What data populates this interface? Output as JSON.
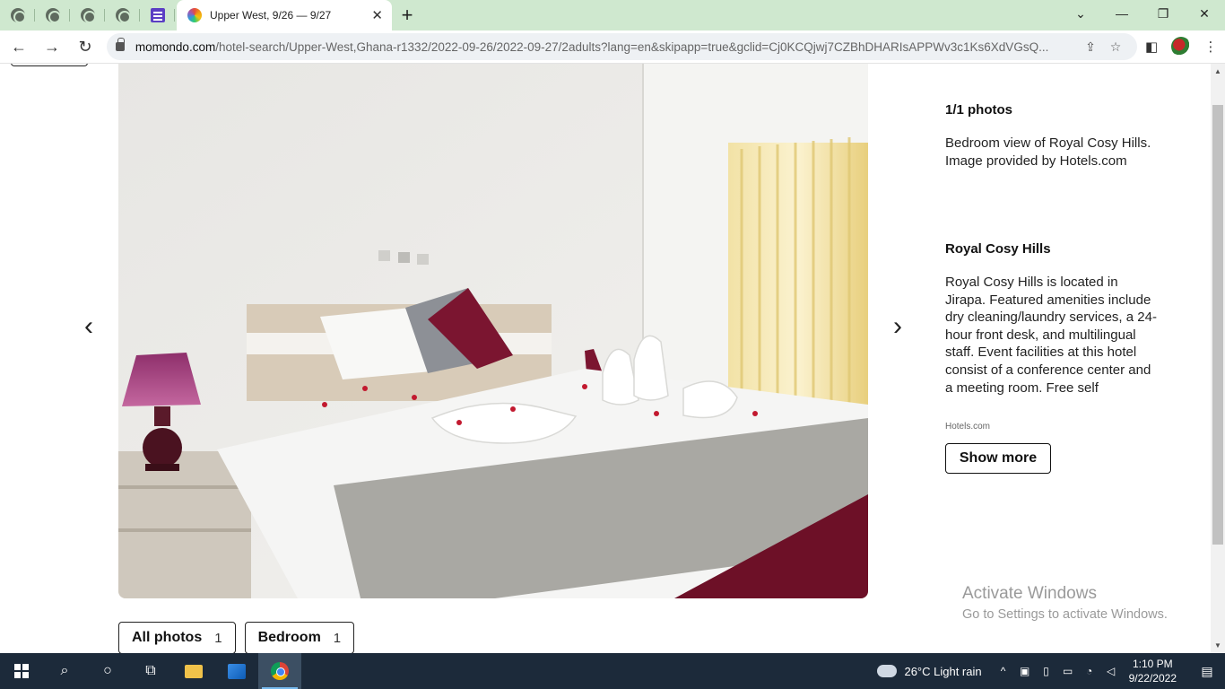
{
  "browser": {
    "tab_title": "Upper West, 9/26 — 9/27",
    "url_domain": "momondo.com",
    "url_path": "/hotel-search/Upper-West,Ghana-r1332/2022-09-26/2022-09-27/2adults?lang=en&skipapp=true&gclid=Cj0KCQjwj7CZBhDHARIsAPPWv3c1Ks6XdVGsQ...",
    "icons": [
      "globe-icon",
      "sheets-icon",
      "momondo-favicon",
      "close-icon",
      "new-tab-icon",
      "back-icon",
      "forward-icon",
      "reload-icon",
      "lock-icon",
      "share-icon",
      "star-icon",
      "side-panel-icon",
      "avatar"
    ]
  },
  "gallery": {
    "photo_count": "1/1 photos",
    "photo_caption": "Bedroom view of Royal Cosy Hills. Image provided by Hotels.com"
  },
  "hotel": {
    "name": "Royal Cosy Hills",
    "description": "Royal Cosy Hills is located in Jirapa. Featured amenities include dry cleaning/laundry services, a 24-hour front desk, and multilingual staff. Event facilities at this hotel consist of a conference center and a meeting room. Free self",
    "source": "Hotels.com",
    "show_more_label": "Show more"
  },
  "filters": [
    {
      "label": "All photos",
      "count": "1"
    },
    {
      "label": "Bedroom",
      "count": "1"
    }
  ],
  "watermark": {
    "line1": "Activate Windows",
    "line2": "Go to Settings to activate Windows."
  },
  "taskbar": {
    "weather": "26°C  Light rain",
    "time": "1:10 PM",
    "date": "9/22/2022"
  }
}
